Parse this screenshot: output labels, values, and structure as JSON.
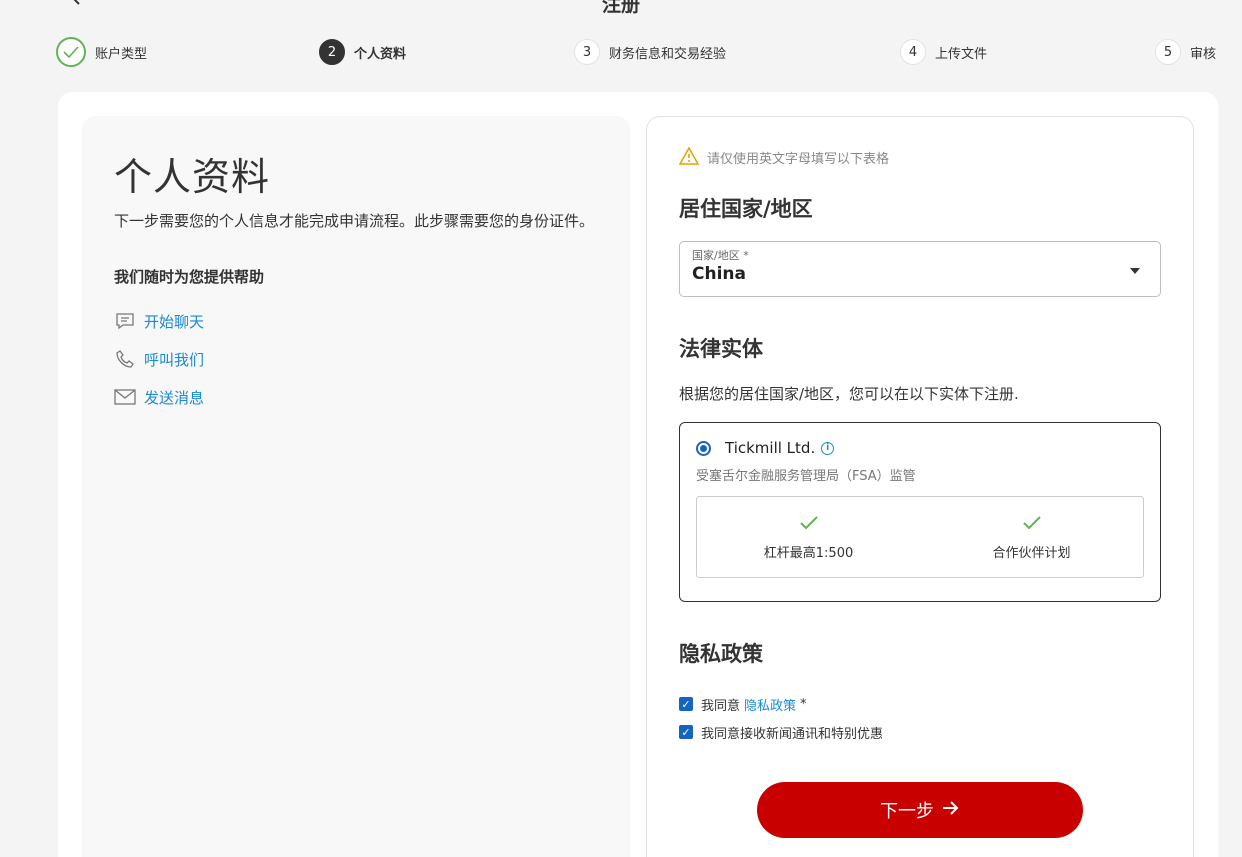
{
  "header": {
    "title": "注册",
    "back_icon": "arrow-left-icon"
  },
  "stepper": {
    "steps": [
      {
        "number": "",
        "label": "账户类型",
        "state": "done"
      },
      {
        "number": "2",
        "label": "个人资料",
        "state": "active"
      },
      {
        "number": "3",
        "label": "财务信息和交易经验",
        "state": "pending"
      },
      {
        "number": "4",
        "label": "上传文件",
        "state": "pending"
      },
      {
        "number": "5",
        "label": "审核",
        "state": "pending"
      }
    ]
  },
  "left": {
    "heading": "个人资料",
    "description": "下一步需要您的个人信息才能完成申请流程。此步骤需要您的身份证件。",
    "help_title": "我们随时为您提供帮助",
    "help_links": [
      {
        "label": "开始聊天",
        "icon": "chat-icon"
      },
      {
        "label": "呼叫我们",
        "icon": "phone-icon"
      },
      {
        "label": "发送消息",
        "icon": "mail-icon"
      }
    ]
  },
  "form": {
    "warning": "请仅使用英文字母填写以下表格",
    "residence": {
      "title": "居住国家/地区",
      "field_label": "国家/地区 *",
      "value": "China"
    },
    "entity": {
      "title": "法律实体",
      "description": "根据您的居住国家/地区，您可以在以下实体下注册.",
      "name": "Tickmill Ltd.",
      "regulator": "受塞舌尔金融服务管理局（FSA）监管",
      "features": [
        "杠杆最高1:500",
        "合作伙伴计划"
      ]
    },
    "privacy": {
      "title": "隐私政策",
      "agree_prefix": "我同意",
      "agree_link": "隐私政策",
      "agree_suffix": "*",
      "newsletter": "我同意接收新闻通讯和特别优惠"
    },
    "next_button": "下一步"
  },
  "colors": {
    "accent_red": "#c80000",
    "link_blue": "#1a8ad1",
    "success_green": "#5fb551",
    "warning_orange": "#e6a100"
  }
}
